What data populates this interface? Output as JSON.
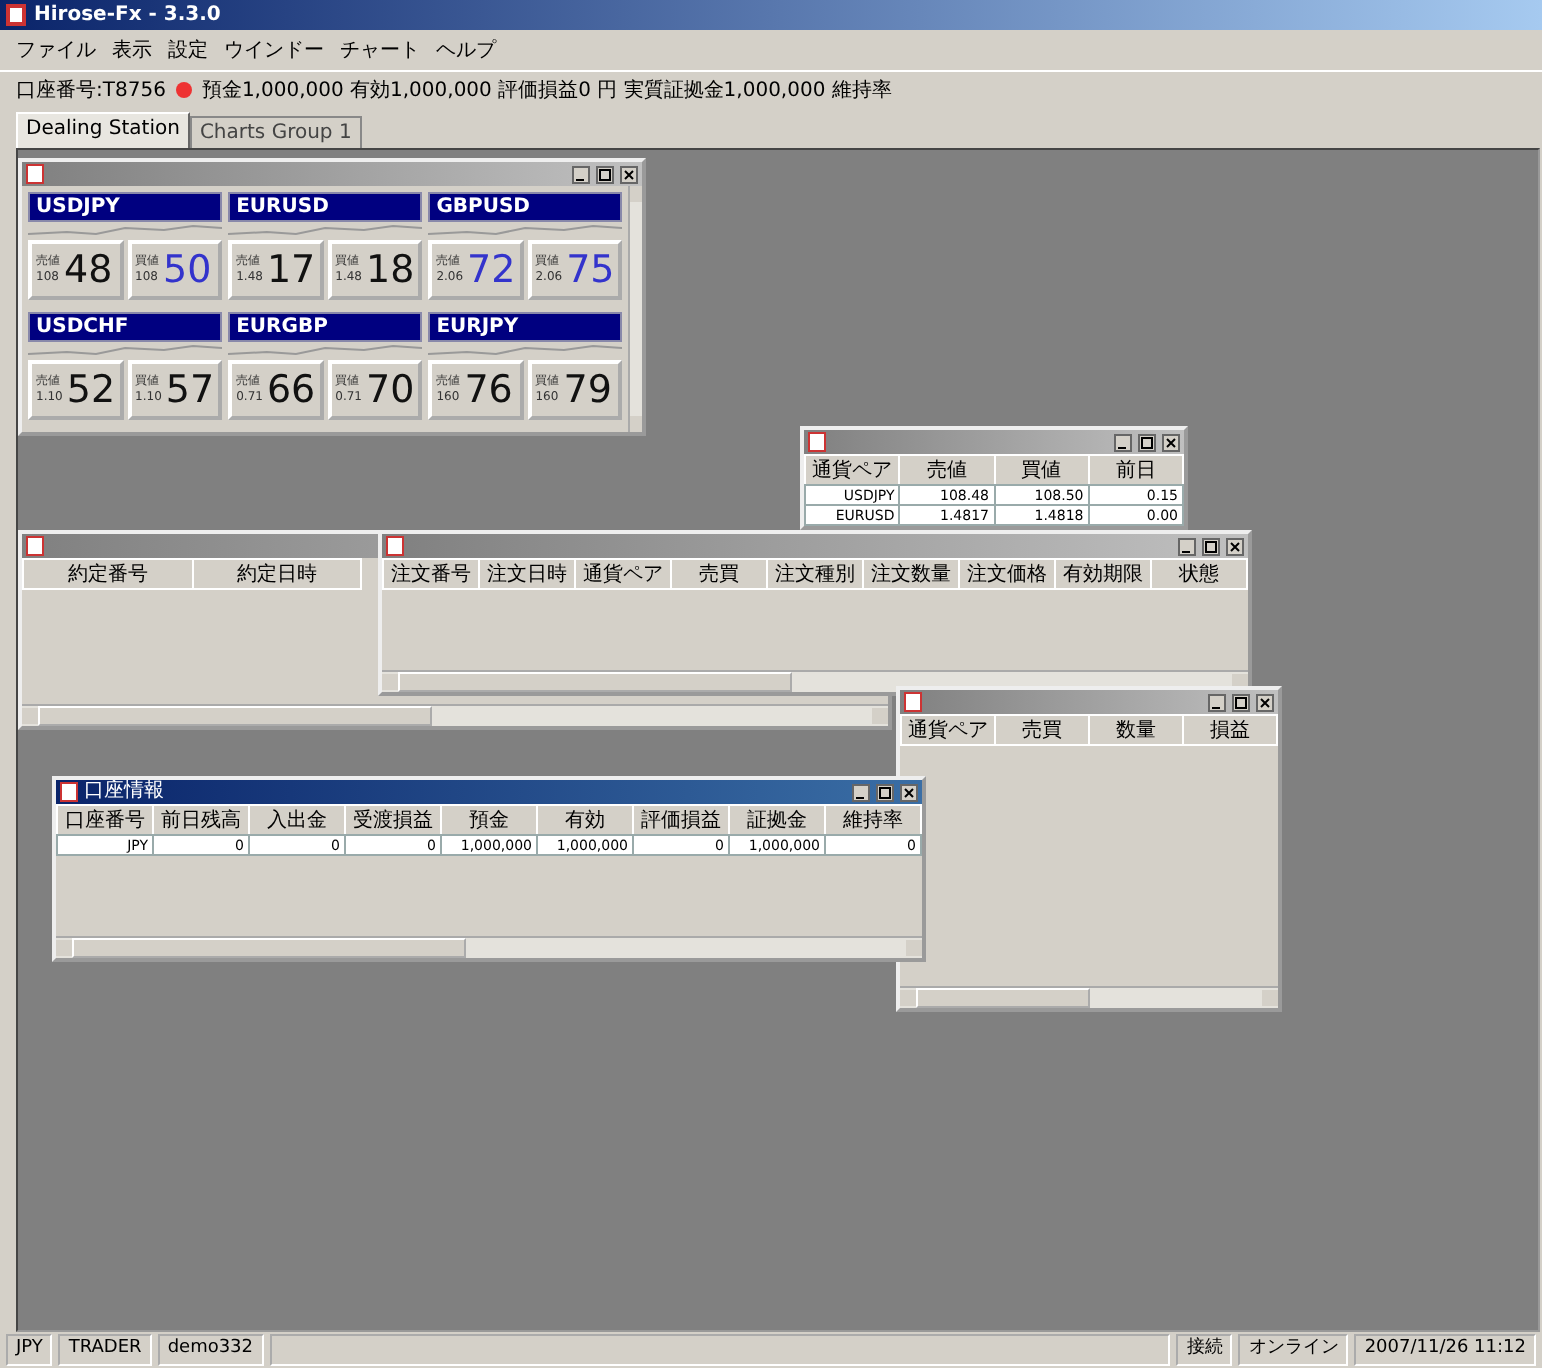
{
  "window": {
    "title": "Hirose-Fx - 3.3.0"
  },
  "menu": [
    "ファイル",
    "表示",
    "設定",
    "ウインドー",
    "チャート",
    "ヘルプ"
  ],
  "account_bar": {
    "account": "口座番号:T8756",
    "connected": true,
    "summary": "預金1,000,000 有効1,000,000 評価損益0 円 実質証拠金1,000,000 維持率"
  },
  "tabs": [
    {
      "label": "Dealing Station",
      "selected": true
    },
    {
      "label": "Charts Group 1",
      "selected": false
    }
  ],
  "windows": [
    {
      "kind": "rates",
      "active": false,
      "pairs": [
        {
          "name": "USDJPY",
          "bid": {
            "label": "売値",
            "big": "108",
            "value": "48",
            "up": false
          },
          "ask": {
            "label": "買値",
            "big": "108",
            "value": "50",
            "up": true
          }
        },
        {
          "name": "EURUSD",
          "bid": {
            "label": "売値",
            "big": "1.48",
            "value": "17",
            "up": false
          },
          "ask": {
            "label": "買値",
            "big": "1.48",
            "value": "18",
            "up": false
          }
        },
        {
          "name": "GBPUSD",
          "bid": {
            "label": "売値",
            "big": "2.06",
            "value": "72",
            "up": true
          },
          "ask": {
            "label": "買値",
            "big": "2.06",
            "value": "75",
            "up": true
          }
        },
        {
          "name": "USDCHF",
          "bid": {
            "label": "売値",
            "big": "1.10",
            "value": "52",
            "up": false
          },
          "ask": {
            "label": "買値",
            "big": "1.10",
            "value": "57",
            "up": false
          }
        },
        {
          "name": "EURGBP",
          "bid": {
            "label": "売値",
            "big": "0.71",
            "value": "66",
            "up": false
          },
          "ask": {
            "label": "買値",
            "big": "0.71",
            "value": "70",
            "up": false
          }
        },
        {
          "name": "EURJPY",
          "bid": {
            "label": "売値",
            "big": "160",
            "value": "76",
            "up": false
          },
          "ask": {
            "label": "買値",
            "big": "160",
            "value": "79",
            "up": false
          }
        }
      ]
    },
    {
      "kind": "table",
      "active": false,
      "columns": [
        "通貨ペア",
        "売値",
        "買値",
        "前日"
      ],
      "rows": [
        [
          "USDJPY",
          "108.48",
          "108.50",
          "0.15"
        ],
        [
          "EURUSD",
          "1.4817",
          "1.4818",
          "0.00"
        ]
      ]
    },
    {
      "kind": "table",
      "active": false,
      "columns": [
        "約定番号",
        "約定日時"
      ]
    },
    {
      "kind": "table",
      "active": false,
      "columns": [
        "注文番号",
        "注文日時",
        "通貨ペア",
        "売買",
        "注文種別",
        "注文数量",
        "注文価格",
        "有効期限",
        "状態"
      ]
    },
    {
      "kind": "table",
      "active": false,
      "columns": [
        "通貨ペア",
        "売買",
        "数量",
        "損益"
      ]
    },
    {
      "kind": "table",
      "active": true,
      "title": "口座情報",
      "columns": [
        "口座番号",
        "前日残高",
        "入出金",
        "受渡損益",
        "預金",
        "有効",
        "評価損益",
        "証拠金",
        "維持率"
      ],
      "rows": [
        [
          "JPY",
          "0",
          "0",
          "0",
          "1,000,000",
          "1,000,000",
          "0",
          "1,000,000",
          "0"
        ]
      ]
    }
  ],
  "status_bar": {
    "left": [
      "JPY",
      "TRADER",
      "demo332"
    ],
    "right": [
      "接続",
      "オンライン",
      "2007/11/26 11:12"
    ]
  }
}
